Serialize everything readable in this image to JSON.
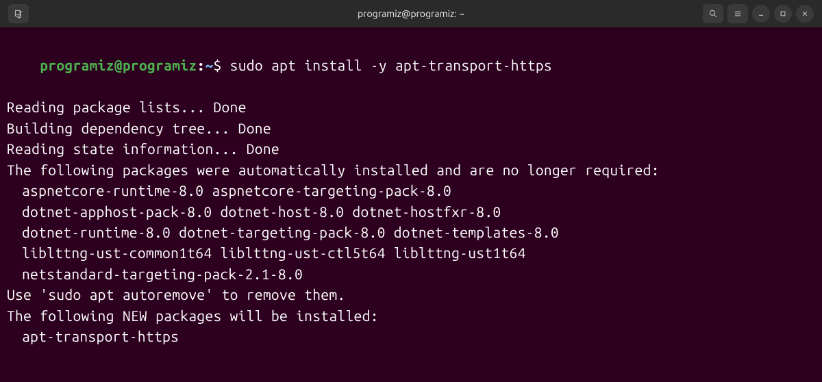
{
  "titlebar": {
    "title": "programiz@programiz: ~"
  },
  "prompt": {
    "user": "programiz",
    "at": "@",
    "host": "programiz",
    "colon": ":",
    "path": "~",
    "symbol": "$"
  },
  "command": "sudo apt install -y apt-transport-https",
  "output": {
    "l1": "Reading package lists... Done",
    "l2": "Building dependency tree... Done",
    "l3": "Reading state information... Done",
    "l4": "The following packages were automatically installed and are no longer required:",
    "pkg1": "aspnetcore-runtime-8.0 aspnetcore-targeting-pack-8.0",
    "pkg2": "dotnet-apphost-pack-8.0 dotnet-host-8.0 dotnet-hostfxr-8.0",
    "pkg3": "dotnet-runtime-8.0 dotnet-targeting-pack-8.0 dotnet-templates-8.0",
    "pkg4": "liblttng-ust-common1t64 liblttng-ust-ctl5t64 liblttng-ust1t64",
    "pkg5": "netstandard-targeting-pack-2.1-8.0",
    "l5": "Use 'sudo apt autoremove' to remove them.",
    "l6": "The following NEW packages will be installed:",
    "newpkg1": "apt-transport-https"
  }
}
